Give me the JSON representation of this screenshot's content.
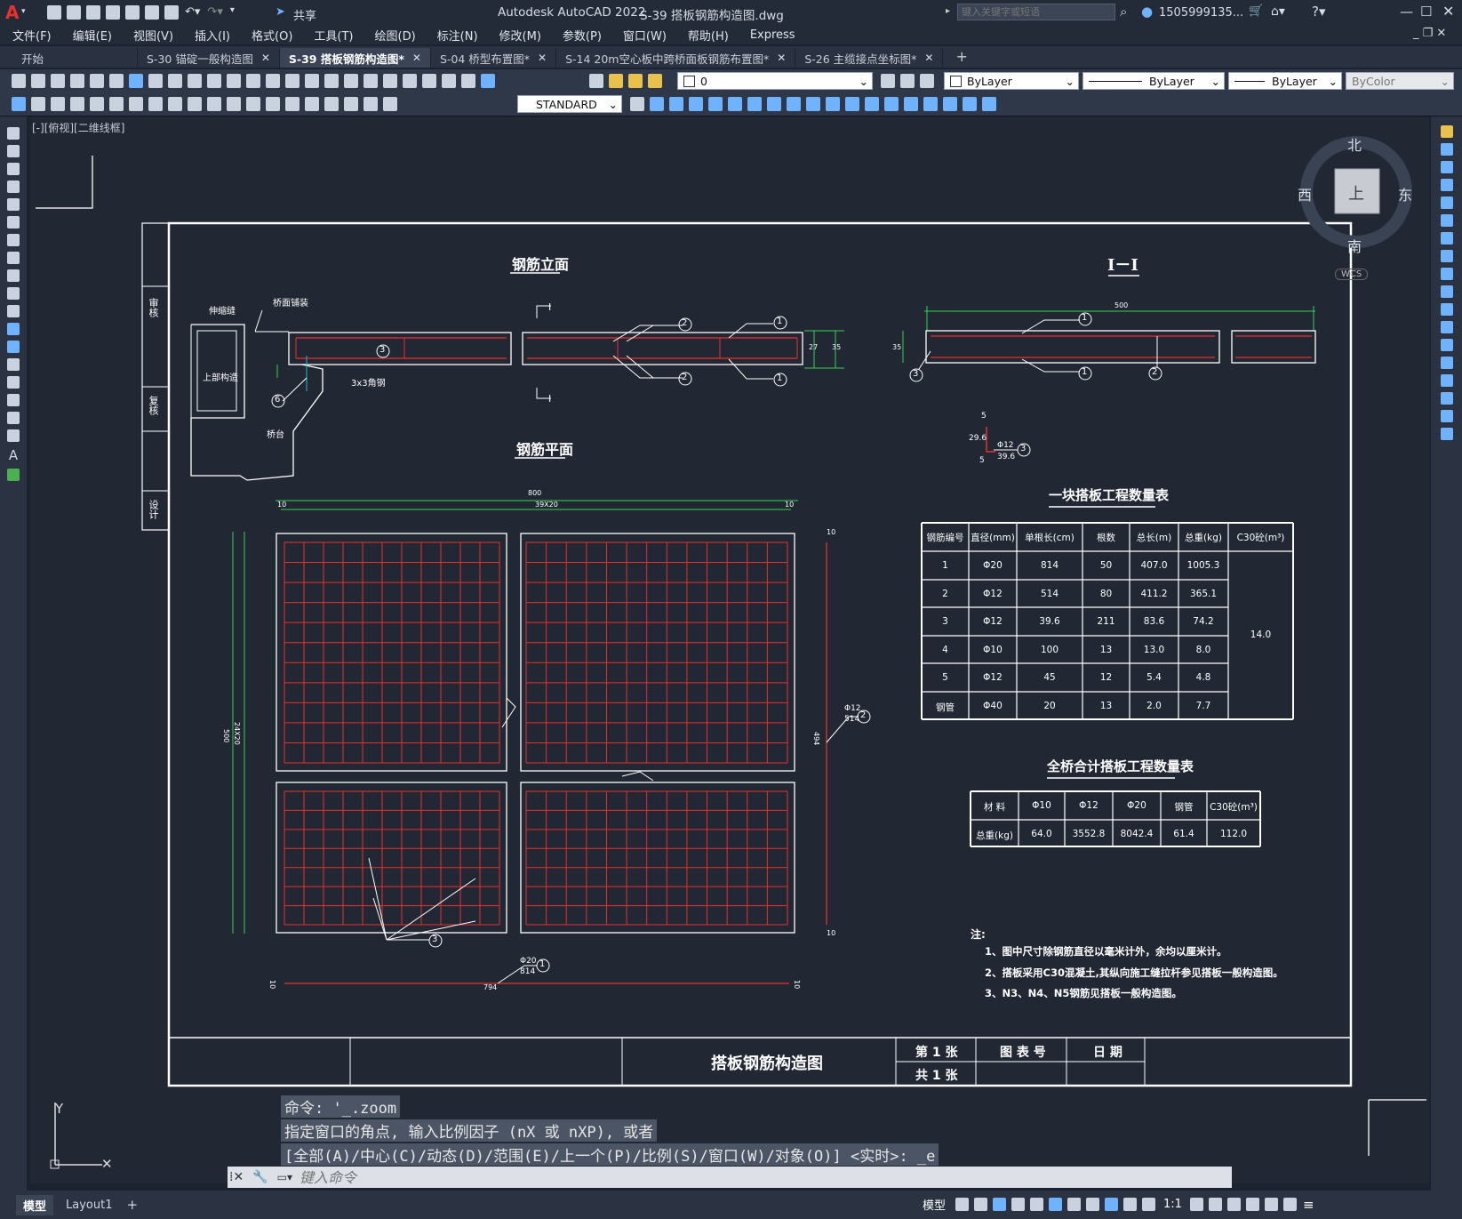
{
  "app": {
    "title": "Autodesk AutoCAD 2022",
    "file": "S-39 搭板钢筋构造图.dwg",
    "share_label": "共享",
    "search_placeholder": "键入关键字或短语",
    "user": "1505999135...",
    "accent": "#e8302c"
  },
  "menu": [
    "文件(F)",
    "编辑(E)",
    "视图(V)",
    "插入(I)",
    "格式(O)",
    "工具(T)",
    "绘图(D)",
    "标注(N)",
    "修改(M)",
    "参数(P)",
    "窗口(W)",
    "帮助(H)",
    "Express"
  ],
  "tabs": [
    {
      "label": "开始",
      "active": false,
      "closable": false
    },
    {
      "label": "S-30 锚碇一般构造图",
      "active": false,
      "closable": true
    },
    {
      "label": "S-39 搭板钢筋构造图*",
      "active": true,
      "closable": true
    },
    {
      "label": "S-04 桥型布置图*",
      "active": false,
      "closable": true
    },
    {
      "label": "S-14 20m空心板中跨桥面板钢筋布置图*",
      "active": false,
      "closable": true
    },
    {
      "label": "S-26 主缆接点坐标图*",
      "active": false,
      "closable": true
    }
  ],
  "properties": {
    "layer": "0",
    "color": "ByLayer",
    "linetype": "ByLayer",
    "lineweight": "ByLayer",
    "plotstyle": "ByColor",
    "textstyle": "STANDARD"
  },
  "viewport_label": "[-][俯视][二维线框]",
  "viewcube": {
    "n": "北",
    "s": "南",
    "e": "东",
    "w": "西",
    "top": "上",
    "wcs": "WCS"
  },
  "drawing": {
    "title_block": {
      "drawing_title": "搭板钢筋构造图",
      "sheet": "第 1 张",
      "total": "共 1 张",
      "fig_no_label": "图 表 号",
      "date_label": "日 期"
    },
    "side_labels": [
      "审核",
      "复核",
      "设计"
    ],
    "elevation_title": "钢筋立面",
    "section_title": "I－I",
    "plan_title": "钢筋平面",
    "labels": {
      "expansion": "伸缩缝",
      "deck_pave": "桥面铺装",
      "superstructure": "上部构造",
      "abutment": "桥台",
      "angle": "3x3角钢",
      "sec_mark": "I",
      "dim_500": "500",
      "dim_800": "800",
      "dim_39x20": "39X20",
      "dim_10": "10",
      "dim_24x20": "24X20",
      "dim_494": "494",
      "dim_794": "794",
      "dim_27": "27",
      "dim_35": "35",
      "rebar2": "Φ12",
      "rebar2_len": "514",
      "rebar1": "Φ20",
      "rebar1_len": "814",
      "rebar3": "Φ12",
      "rebar3_len": "39.6",
      "rebar3_a": "5",
      "rebar3_b": "29.6"
    },
    "table1": {
      "title": "一块搭板工程数量表",
      "headers": [
        "钢筋编号",
        "直径(mm)",
        "单根长(cm)",
        "根数",
        "总长(m)",
        "总重(kg)",
        "C30砼(m³)"
      ],
      "rows": [
        [
          "1",
          "Φ20",
          "814",
          "50",
          "407.0",
          "1005.3"
        ],
        [
          "2",
          "Φ12",
          "514",
          "80",
          "411.2",
          "365.1"
        ],
        [
          "3",
          "Φ12",
          "39.6",
          "211",
          "83.6",
          "74.2"
        ],
        [
          "4",
          "Φ10",
          "100",
          "13",
          "13.0",
          "8.0"
        ],
        [
          "5",
          "Φ12",
          "45",
          "12",
          "5.4",
          "4.8"
        ],
        [
          "钢管",
          "Φ40",
          "20",
          "13",
          "2.0",
          "7.7"
        ]
      ],
      "concrete": "14.0"
    },
    "table2": {
      "title": "全桥合计搭板工程数量表",
      "headers": [
        "材 料",
        "Φ10",
        "Φ12",
        "Φ20",
        "钢管",
        "C30砼(m³)"
      ],
      "row": [
        "总重(kg)",
        "64.0",
        "3552.8",
        "8042.4",
        "61.4",
        "112.0"
      ]
    },
    "notes": {
      "title": "注:",
      "items": [
        "1、图中尺寸除钢筋直径以毫米计外，余均以厘米计。",
        "2、搭板采用C30混凝土,其纵向施工缝拉杆参见搭板一般构造图。",
        "3、N3、N4、N5钢筋见搭板一般构造图。"
      ]
    }
  },
  "command": {
    "history": [
      "命令: '_.zoom",
      "指定窗口的角点, 输入比例因子 (nX 或 nXP), 或者",
      "[全部(A)/中心(C)/动态(D)/范围(E)/上一个(P)/比例(S)/窗口(W)/对象(O)] <实时>: _e"
    ],
    "placeholder": "键入命令"
  },
  "status": {
    "layouts": [
      "模型",
      "Layout1"
    ],
    "model_label": "模型",
    "scale": "1:1"
  }
}
